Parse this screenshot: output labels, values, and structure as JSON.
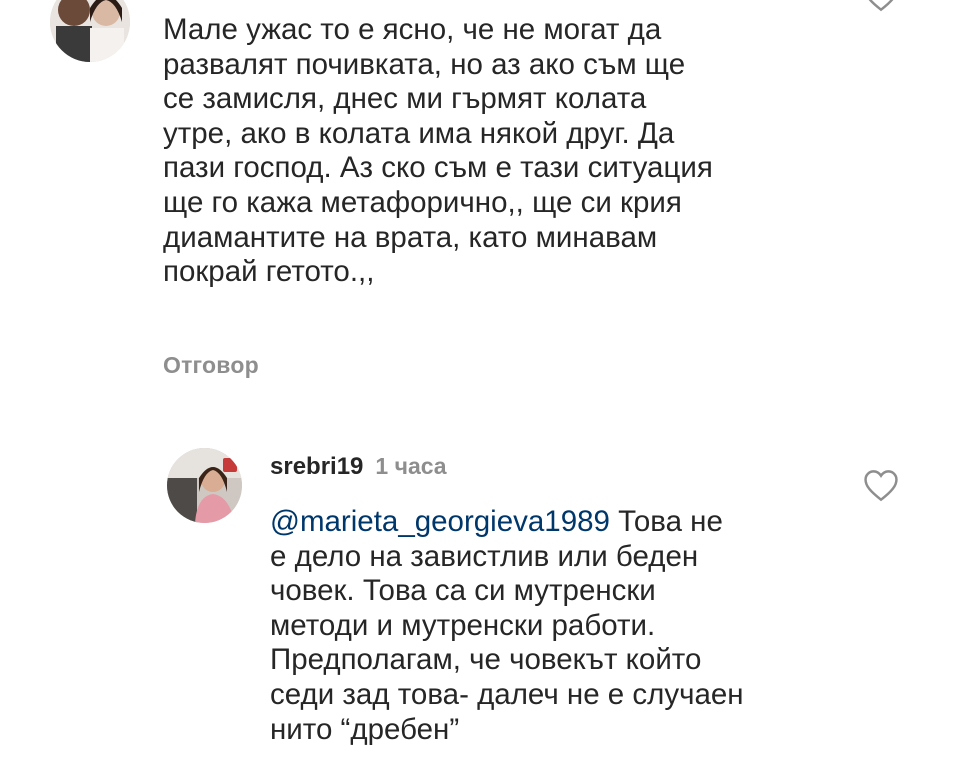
{
  "comments": [
    {
      "text": "Мале ужас то е ясно, че не могат да\nразвалят почивката, но аз ако съм ще\nсе замисля, днес ми гърмят колата\nутре, ако в колата има някой друг. Да\nпази господ. Аз ско съм е тази ситуация\nще го кажа метафорично,, ще си крия\nдиамантите на врата, като минавам\nпокрай гетото.,,",
      "reply_label": "Отговор",
      "avatar_icon": "user-avatar-couple",
      "like_icon": "heart-outline-icon"
    },
    {
      "username": "srebri19",
      "time": "1 часа",
      "mention": "@marieta_georgieva1989",
      "text_first": " Това не",
      "text": "е дело на завистлив или беден\nчовек. Това са си мутренски\nметоди и мутренски работи.\nПредполагам, че човекът който\nседи зад това- далеч не е случаен\nнито “дребен”",
      "avatar_icon": "user-avatar-woman-in-car",
      "like_icon": "heart-outline-icon"
    }
  ],
  "colors": {
    "text": "#262626",
    "muted": "#8e8e8e",
    "mention": "#00376b"
  }
}
